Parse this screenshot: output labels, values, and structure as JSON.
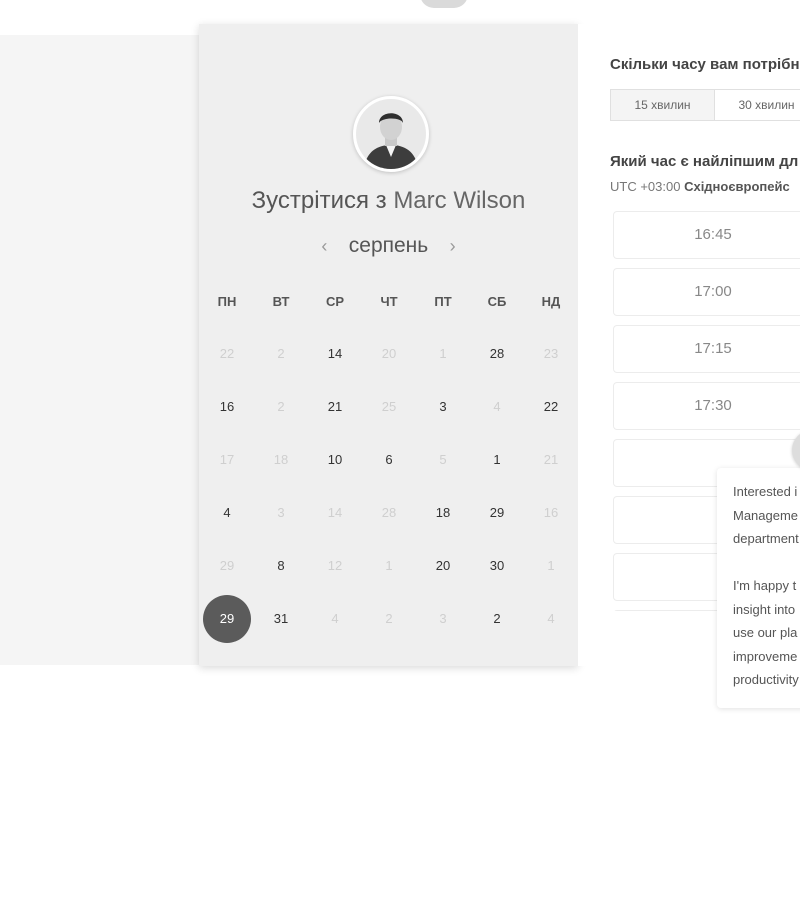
{
  "meeting": {
    "title_prefix": "Зустрітися з",
    "host_name": "Marc Wilson",
    "month": "серпень",
    "prev_arrow": "‹",
    "next_arrow": "›"
  },
  "calendar": {
    "weekdays": [
      "ПН",
      "ВТ",
      "СР",
      "ЧТ",
      "ПТ",
      "СБ",
      "НД"
    ],
    "rows": [
      [
        {
          "d": "22",
          "s": "dim"
        },
        {
          "d": "2",
          "s": "dim"
        },
        {
          "d": "14",
          "s": "active"
        },
        {
          "d": "20",
          "s": "dim"
        },
        {
          "d": "1",
          "s": "dim"
        },
        {
          "d": "28",
          "s": "active"
        },
        {
          "d": "23",
          "s": "dim"
        }
      ],
      [
        {
          "d": "16",
          "s": "active"
        },
        {
          "d": "2",
          "s": "dim"
        },
        {
          "d": "21",
          "s": "active"
        },
        {
          "d": "25",
          "s": "dim"
        },
        {
          "d": "3",
          "s": "active"
        },
        {
          "d": "4",
          "s": "dim"
        },
        {
          "d": "22",
          "s": "active"
        }
      ],
      [
        {
          "d": "17",
          "s": "dim"
        },
        {
          "d": "18",
          "s": "dim"
        },
        {
          "d": "10",
          "s": "active"
        },
        {
          "d": "6",
          "s": "active"
        },
        {
          "d": "5",
          "s": "dim"
        },
        {
          "d": "1",
          "s": "active"
        },
        {
          "d": "21",
          "s": "dim"
        }
      ],
      [
        {
          "d": "4",
          "s": "active"
        },
        {
          "d": "3",
          "s": "dim"
        },
        {
          "d": "14",
          "s": "dim"
        },
        {
          "d": "28",
          "s": "dim"
        },
        {
          "d": "18",
          "s": "active"
        },
        {
          "d": "29",
          "s": "active"
        },
        {
          "d": "16",
          "s": "dim"
        }
      ],
      [
        {
          "d": "29",
          "s": "dim"
        },
        {
          "d": "8",
          "s": "active"
        },
        {
          "d": "12",
          "s": "dim"
        },
        {
          "d": "1",
          "s": "dim"
        },
        {
          "d": "20",
          "s": "active"
        },
        {
          "d": "30",
          "s": "active"
        },
        {
          "d": "1",
          "s": "dim"
        }
      ],
      [
        {
          "d": "29",
          "s": "selected"
        },
        {
          "d": "31",
          "s": "active"
        },
        {
          "d": "4",
          "s": "dim"
        },
        {
          "d": "2",
          "s": "dim"
        },
        {
          "d": "3",
          "s": "dim"
        },
        {
          "d": "2",
          "s": "active"
        },
        {
          "d": "4",
          "s": "dim"
        }
      ]
    ]
  },
  "booking": {
    "duration_question": "Скільки часу вам потрібн",
    "durations": [
      "15 хвилин",
      "30 хвилин"
    ],
    "time_question": "Який час є найліпшим дл",
    "tz_offset": "UTC +03:00",
    "tz_name": "Східноєвропейс",
    "slots": [
      "16:45",
      "17:00",
      "17:15",
      "17:30",
      "",
      "",
      "",
      ""
    ]
  },
  "chat": {
    "para1": "Interested i\nManageme\ndepartment",
    "para2": "I'm happy t\ninsight into\nuse our pla\nimproveme\nproductivity"
  },
  "colors": {
    "page_bg": "#f5f5f5",
    "panel_bg": "#efefef",
    "selected_day": "#5b5b5b"
  }
}
